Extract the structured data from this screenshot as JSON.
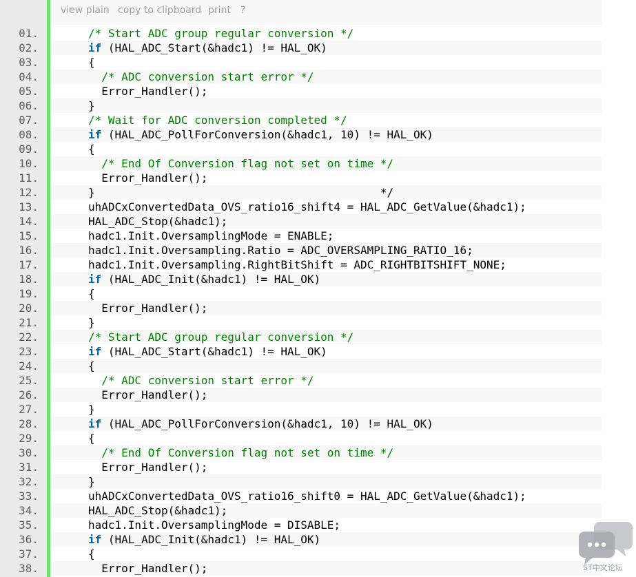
{
  "toolbar": {
    "view_plain": "view plain",
    "copy": "copy to clipboard",
    "print": "print",
    "help": "?"
  },
  "watermark": {
    "text": "ST中文论坛"
  },
  "lines": [
    {
      "num": "01.",
      "tokens": [
        {
          "t": "/* Start ADC group regular conversion */",
          "c": "cm"
        }
      ]
    },
    {
      "num": "02.",
      "tokens": [
        {
          "t": "if",
          "c": "kw"
        },
        {
          "t": " (HAL_ADC_Start(&hadc1) != HAL_OK)"
        }
      ]
    },
    {
      "num": "03.",
      "tokens": [
        {
          "t": "{"
        }
      ]
    },
    {
      "num": "04.",
      "tokens": [
        {
          "t": "  "
        },
        {
          "t": "/* ADC conversion start error */",
          "c": "cm"
        }
      ]
    },
    {
      "num": "05.",
      "tokens": [
        {
          "t": "  Error_Handler();"
        }
      ]
    },
    {
      "num": "06.",
      "tokens": [
        {
          "t": "}"
        }
      ]
    },
    {
      "num": "07.",
      "tokens": [
        {
          "t": "/* Wait for ADC conversion completed */",
          "c": "cm"
        }
      ]
    },
    {
      "num": "08.",
      "tokens": [
        {
          "t": "if",
          "c": "kw"
        },
        {
          "t": " (HAL_ADC_PollForConversion(&hadc1, 10) != HAL_OK)"
        }
      ]
    },
    {
      "num": "09.",
      "tokens": [
        {
          "t": "{"
        }
      ]
    },
    {
      "num": "10.",
      "tokens": [
        {
          "t": "  "
        },
        {
          "t": "/* End Of Conversion flag not set on time */",
          "c": "cm"
        }
      ]
    },
    {
      "num": "11.",
      "tokens": [
        {
          "t": "  Error_Handler();"
        }
      ]
    },
    {
      "num": "12.",
      "tokens": [
        {
          "t": "}                                           */"
        }
      ]
    },
    {
      "num": "13.",
      "tokens": [
        {
          "t": "uhADCxConvertedData_OVS_ratio16_shift4 = HAL_ADC_GetValue(&hadc1);"
        }
      ]
    },
    {
      "num": "14.",
      "tokens": [
        {
          "t": "HAL_ADC_Stop(&hadc1);"
        }
      ]
    },
    {
      "num": "15.",
      "tokens": [
        {
          "t": "hadc1.Init.OversamplingMode = ENABLE;"
        }
      ]
    },
    {
      "num": "16.",
      "tokens": [
        {
          "t": "hadc1.Init.Oversampling.Ratio = ADC_OVERSAMPLING_RATIO_16;"
        }
      ]
    },
    {
      "num": "17.",
      "tokens": [
        {
          "t": "hadc1.Init.Oversampling.RightBitShift = ADC_RIGHTBITSHIFT_NONE;"
        }
      ]
    },
    {
      "num": "18.",
      "tokens": [
        {
          "t": "if",
          "c": "kw"
        },
        {
          "t": " (HAL_ADC_Init(&hadc1) != HAL_OK)"
        }
      ]
    },
    {
      "num": "19.",
      "tokens": [
        {
          "t": "{"
        }
      ]
    },
    {
      "num": "20.",
      "tokens": [
        {
          "t": "  Error_Handler();"
        }
      ]
    },
    {
      "num": "21.",
      "tokens": [
        {
          "t": "}"
        }
      ]
    },
    {
      "num": "22.",
      "tokens": [
        {
          "t": "/* Start ADC group regular conversion */",
          "c": "cm"
        }
      ]
    },
    {
      "num": "23.",
      "tokens": [
        {
          "t": "if",
          "c": "kw"
        },
        {
          "t": " (HAL_ADC_Start(&hadc1) != HAL_OK)"
        }
      ]
    },
    {
      "num": "24.",
      "tokens": [
        {
          "t": "{"
        }
      ]
    },
    {
      "num": "25.",
      "tokens": [
        {
          "t": "  "
        },
        {
          "t": "/* ADC conversion start error */",
          "c": "cm"
        }
      ]
    },
    {
      "num": "26.",
      "tokens": [
        {
          "t": "  Error_Handler();"
        }
      ]
    },
    {
      "num": "27.",
      "tokens": [
        {
          "t": "}"
        }
      ]
    },
    {
      "num": "28.",
      "tokens": [
        {
          "t": "if",
          "c": "kw"
        },
        {
          "t": " (HAL_ADC_PollForConversion(&hadc1, 10) != HAL_OK)"
        }
      ]
    },
    {
      "num": "29.",
      "tokens": [
        {
          "t": "{"
        }
      ]
    },
    {
      "num": "30.",
      "tokens": [
        {
          "t": "  "
        },
        {
          "t": "/* End Of Conversion flag not set on time */",
          "c": "cm"
        }
      ]
    },
    {
      "num": "31.",
      "tokens": [
        {
          "t": "  Error_Handler();"
        }
      ]
    },
    {
      "num": "32.",
      "tokens": [
        {
          "t": "}"
        }
      ]
    },
    {
      "num": "33.",
      "tokens": [
        {
          "t": "uhADCxConvertedData_OVS_ratio16_shift0 = HAL_ADC_GetValue(&hadc1);"
        }
      ]
    },
    {
      "num": "34.",
      "tokens": [
        {
          "t": "HAL_ADC_Stop(&hadc1);"
        }
      ]
    },
    {
      "num": "35.",
      "tokens": [
        {
          "t": "hadc1.Init.OversamplingMode = DISABLE;"
        }
      ]
    },
    {
      "num": "36.",
      "tokens": [
        {
          "t": "if",
          "c": "kw"
        },
        {
          "t": " (HAL_ADC_Init(&hadc1) != HAL_OK)"
        }
      ]
    },
    {
      "num": "37.",
      "tokens": [
        {
          "t": "{"
        }
      ]
    },
    {
      "num": "38.",
      "tokens": [
        {
          "t": "  Error_Handler();"
        }
      ]
    }
  ]
}
